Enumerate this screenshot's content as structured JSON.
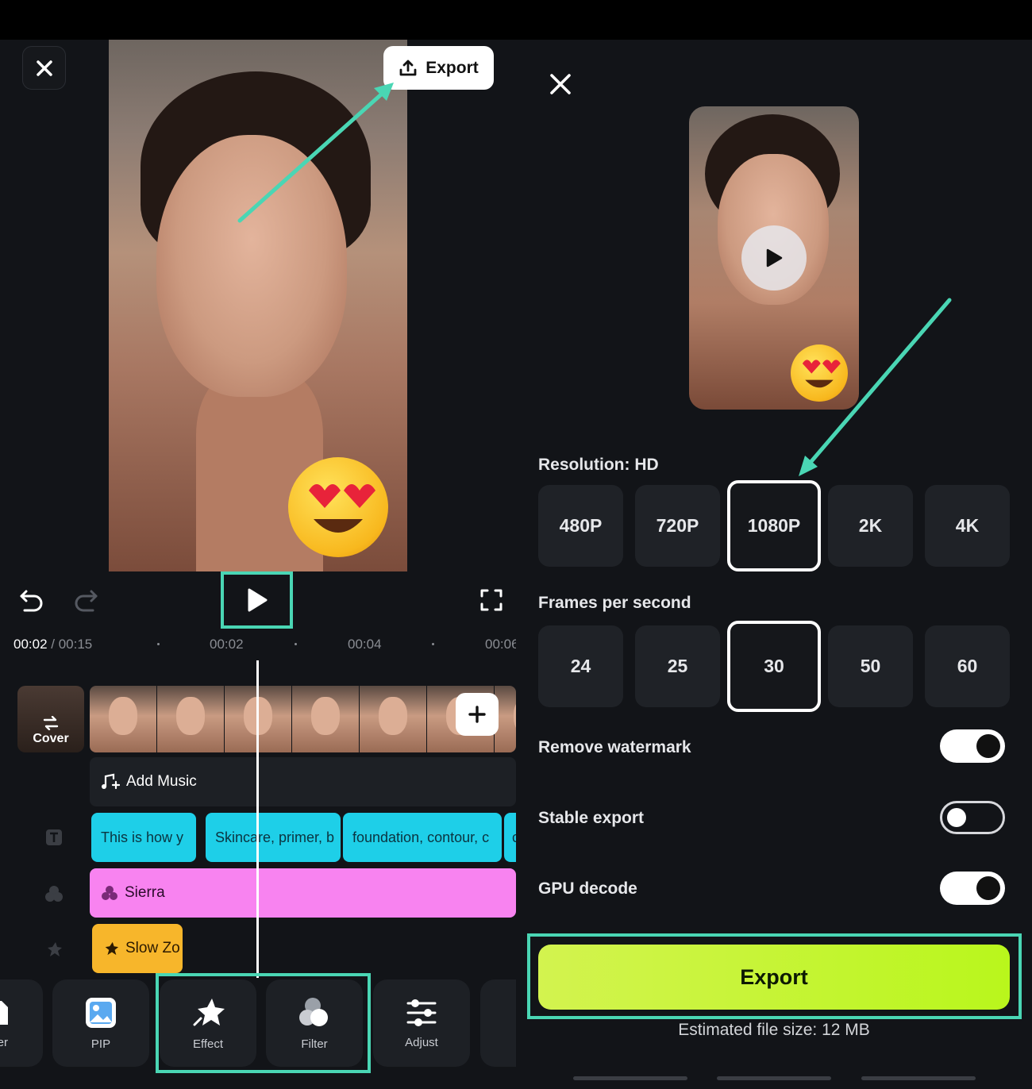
{
  "editor": {
    "export_label": "Export",
    "timecode_current": "00:02",
    "timecode_sep": " / ",
    "timecode_total": "00:15",
    "ticks": [
      "00:02",
      "00:04",
      "00:06"
    ],
    "cover_label": "Cover",
    "add_music_label": "Add Music",
    "text_clips": [
      "This is how y",
      "Skincare, primer, b",
      "foundation, contour, c",
      "c"
    ],
    "filter_clip": "Sierra",
    "effect_clip": "Slow Zo",
    "toolbar": [
      {
        "label": "ker",
        "icon": "sticker-icon"
      },
      {
        "label": "PIP",
        "icon": "pip-icon"
      },
      {
        "label": "Effect",
        "icon": "effect-icon"
      },
      {
        "label": "Filter",
        "icon": "filter-icon"
      },
      {
        "label": "Adjust",
        "icon": "adjust-icon"
      }
    ]
  },
  "export_panel": {
    "resolution_label": "Resolution: HD",
    "resolutions": [
      "480P",
      "720P",
      "1080P",
      "2K",
      "4K"
    ],
    "selected_resolution": "1080P",
    "fps_label": "Frames per second",
    "fps_options": [
      "24",
      "25",
      "30",
      "50",
      "60"
    ],
    "selected_fps": "30",
    "remove_watermark_label": "Remove watermark",
    "remove_watermark": true,
    "stable_export_label": "Stable export",
    "stable_export": false,
    "gpu_decode_label": "GPU decode",
    "gpu_decode": true,
    "export_button": "Export",
    "file_size": "Estimated file size: 12 MB"
  },
  "colors": {
    "accent_highlight": "#4ad6b4",
    "export_button": "#c4f52f",
    "text_clip": "#1ecfe8",
    "filter_clip": "#f883f0",
    "effect_clip": "#f7b62b"
  }
}
